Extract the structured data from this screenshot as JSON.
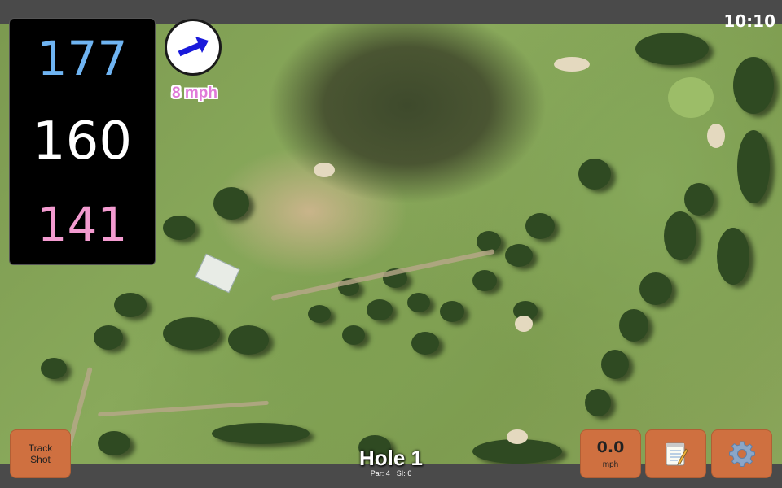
{
  "status": {
    "time": "10:10"
  },
  "yardages": {
    "back": "177",
    "middle": "160",
    "front": "141"
  },
  "wind": {
    "speed": "8 mph",
    "arrow_color": "#1a1adb"
  },
  "hole": {
    "title": "Hole 1",
    "par": "Par: 4",
    "si": "SI: 6"
  },
  "buttons": {
    "track_shot": "Track Shot",
    "speed_value": "0.0",
    "speed_unit": "mph",
    "notes_icon": "notepad-icon",
    "settings_icon": "gear-icon"
  },
  "colors": {
    "button_bg": "#cf7040",
    "back_yardage": "#6fb4f2",
    "middle_yardage": "#ffffff",
    "front_yardage": "#f39bd0",
    "wind_text": "#e07ad8"
  }
}
